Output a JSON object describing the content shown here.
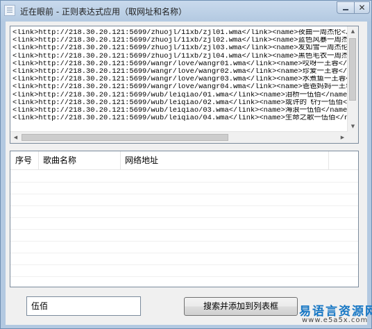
{
  "window": {
    "title": "近在眼前 - 正则表达式应用（取网址和名称）",
    "close_label": "✕"
  },
  "source_text": {
    "lines": [
      "<link>http://218.30.20.121:5699/zhuojl/11xb/zjl01.wma</link><name>夜曲一周杰伦</na",
      "<link>http://218.30.20.121:5699/zhuojl/11xb/zjl02.wma</link><name>蓝色风暴一周杰伦",
      "<link>http://218.30.20.121:5699/zhuojl/11xb/zjl03.wma</link><name>发如雪一周杰伦</",
      "<link>http://218.30.20.121:5699/zhuojl/11xb/zjl04.wma</link><name>黑色毛衣一周杰伦",
      "<link>http://218.30.20.121:5699/wangr/love/wangr01.wma</link><name>哎呀一王蓉</na",
      "<link>http://218.30.20.121:5699/wangr/love/wangr02.wma</link><name>珍爱一王蓉</na",
      "<link>http://218.30.20.121:5699/wangr/love/wangr03.wma</link><name>水煮鱼一王蓉</",
      "<link>http://218.30.20.121:5699/wangr/love/wangr04.wma</link><name>爸爸妈妈一王蓉",
      "<link>http://218.30.20.121:5699/wub/leiqiao/01.wma</link><name>泪桥一伍佰</name>",
      "<link>http://218.30.20.121:5699/wub/leiqiao/02.wma</link><name>或许的飞行一伍佰</",
      "<link>http://218.30.20.121:5699/wub/leiqiao/03.wma</link><name>海浪一伍佰</name>",
      "<link>http://218.30.20.121:5699/wub/leiqiao/04.wma</link><name>生命之歌一伍佰</na"
    ]
  },
  "song_list": {
    "columns": [
      "序号",
      "歌曲名称",
      "网络地址"
    ]
  },
  "search": {
    "input_value": "伍佰",
    "button_label": "搜索并添加到列表框"
  },
  "watermark": {
    "line1": "易语言资源网",
    "line2": "www.e5a5x.com"
  },
  "icons": [
    "app-icon",
    "minimize-icon",
    "close-icon",
    "scroll-up-icon",
    "scroll-down-icon",
    "scroll-left-icon",
    "scroll-right-icon"
  ]
}
